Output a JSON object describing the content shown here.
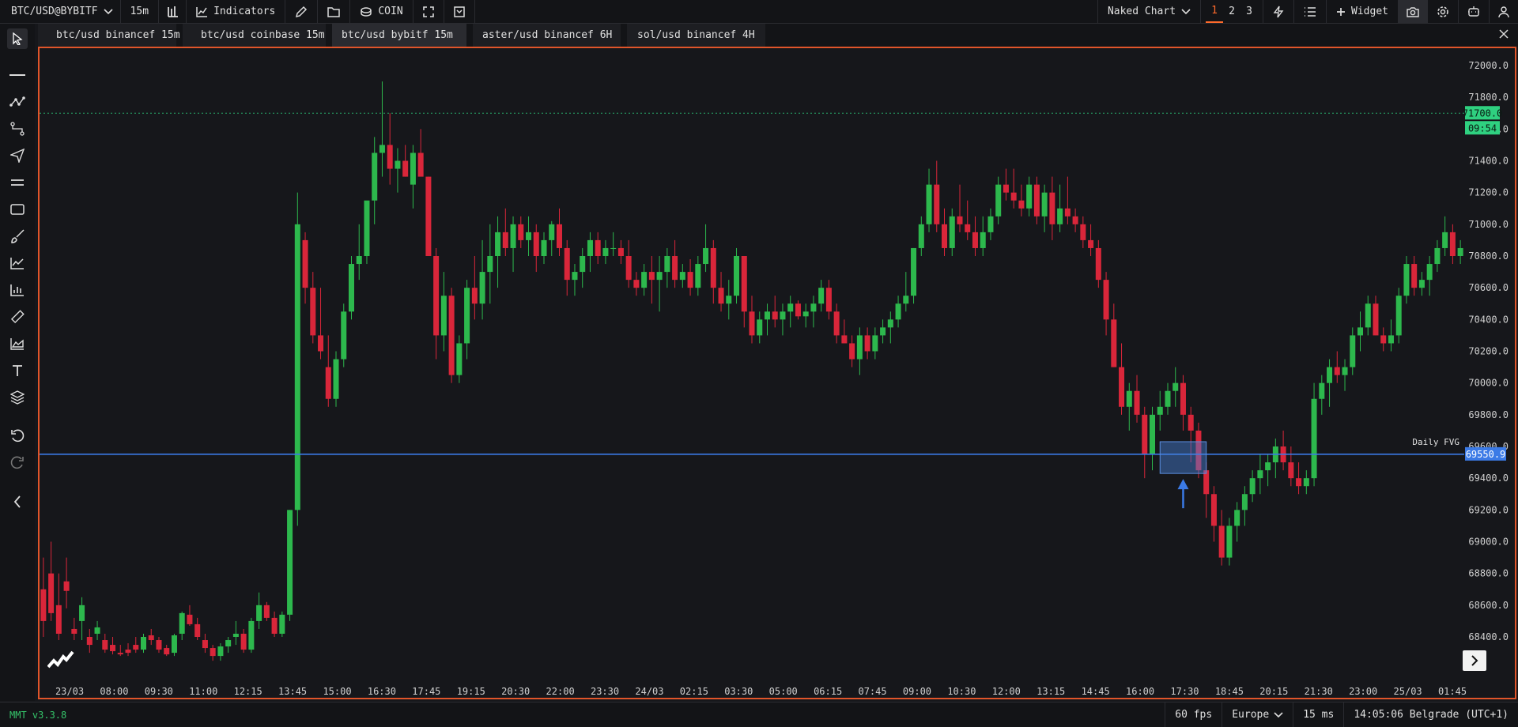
{
  "toolbar": {
    "symbol": "BTC/USD@BYBITF",
    "interval": "15m",
    "indicators_label": "Indicators",
    "coin_label": "COIN",
    "chart_mode": "Naked Chart",
    "layouts": [
      "1",
      "2",
      "3"
    ],
    "active_layout": "1",
    "widget_label": "Widget"
  },
  "tabs": [
    {
      "label": "btc/usd binancef 15m",
      "active": false
    },
    {
      "label": "btc/usd coinbase 15m",
      "active": false
    },
    {
      "label": "btc/usd bybitf 15m",
      "active": true
    },
    {
      "label": "aster/usd binancef 6H",
      "active": false
    },
    {
      "label": "sol/usd binancef 4H",
      "active": false
    }
  ],
  "sidebar": {
    "icons": [
      "cursor-icon",
      "horizontal-line-icon",
      "multi-point-icon",
      "path-icon",
      "send-icon",
      "parallel-lines-icon",
      "rectangle-icon",
      "brush-icon",
      "line-chart-icon",
      "bars-icon",
      "ruler-icon",
      "area-chart-icon",
      "text-icon",
      "layers-icon",
      "undo-icon",
      "redo-icon",
      "collapse-icon"
    ]
  },
  "chart_data": {
    "type": "candlestick",
    "y_axis_labels": [
      "72000.0",
      "71800.0",
      "71600.0",
      "71400.0",
      "71200.0",
      "71000.0",
      "70800.0",
      "70600.0",
      "70400.0",
      "70200.0",
      "70000.0",
      "69800.0",
      "69600.0",
      "69400.0",
      "69200.0",
      "69000.0",
      "68800.0",
      "68600.0",
      "68400.0"
    ],
    "ylim": [
      68400,
      72000
    ],
    "x_axis_labels": [
      "23/03",
      "08:00",
      "09:30",
      "11:00",
      "12:15",
      "13:45",
      "15:00",
      "16:30",
      "17:45",
      "19:15",
      "20:30",
      "22:00",
      "23:30",
      "24/03",
      "02:15",
      "03:30",
      "05:00",
      "06:15",
      "07:45",
      "09:00",
      "10:30",
      "12:00",
      "13:15",
      "14:45",
      "16:00",
      "17:30",
      "18:45",
      "20:15",
      "21:30",
      "23:00",
      "25/03",
      "01:45"
    ],
    "price_line": {
      "value": 71700.0,
      "label": "71700.0",
      "countdown": "09:54",
      "color": "#2fd080"
    },
    "level_line": {
      "value": 69550.9,
      "label": "69550.9",
      "name": "Daily FVG",
      "color": "#3b7ae6"
    },
    "highlight_zone": {
      "from": 69430,
      "to": 69630
    },
    "colors": {
      "up": "#2db84d",
      "down": "#d9263a"
    },
    "ohlc": [
      [
        68700,
        68900,
        68400,
        68500
      ],
      [
        68800,
        69000,
        68500,
        68550
      ],
      [
        68600,
        68800,
        68380,
        68420
      ],
      [
        68750,
        68900,
        68580,
        68690
      ],
      [
        68450,
        68520,
        68380,
        68420
      ],
      [
        68500,
        68650,
        68380,
        68600
      ],
      [
        68400,
        68450,
        68300,
        68350
      ],
      [
        68420,
        68500,
        68380,
        68460
      ],
      [
        68380,
        68420,
        68300,
        68320
      ],
      [
        68350,
        68400,
        68290,
        68310
      ],
      [
        68300,
        68350,
        68280,
        68290
      ],
      [
        68320,
        68360,
        68280,
        68300
      ],
      [
        68350,
        68400,
        68300,
        68320
      ],
      [
        68320,
        68420,
        68300,
        68400
      ],
      [
        68410,
        68450,
        68350,
        68380
      ],
      [
        68380,
        68400,
        68300,
        68320
      ],
      [
        68330,
        68350,
        68280,
        68290
      ],
      [
        68300,
        68420,
        68280,
        68410
      ],
      [
        68420,
        68560,
        68380,
        68550
      ],
      [
        68540,
        68600,
        68470,
        68480
      ],
      [
        68480,
        68520,
        68380,
        68400
      ],
      [
        68380,
        68420,
        68300,
        68330
      ],
      [
        68330,
        68350,
        68250,
        68280
      ],
      [
        68280,
        68360,
        68250,
        68340
      ],
      [
        68340,
        68400,
        68300,
        68380
      ],
      [
        68400,
        68500,
        68350,
        68420
      ],
      [
        68420,
        68450,
        68300,
        68320
      ],
      [
        68320,
        68520,
        68300,
        68500
      ],
      [
        68500,
        68680,
        68450,
        68600
      ],
      [
        68600,
        68620,
        68500,
        68520
      ],
      [
        68520,
        68560,
        68400,
        68420
      ],
      [
        68420,
        68560,
        68400,
        68540
      ],
      [
        68540,
        69200,
        68500,
        69200
      ],
      [
        69200,
        71200,
        69100,
        71000
      ],
      [
        70900,
        70950,
        70500,
        70600
      ],
      [
        70600,
        70700,
        70250,
        70300
      ],
      [
        70300,
        70600,
        70150,
        70200
      ],
      [
        70100,
        70300,
        69850,
        69900
      ],
      [
        69900,
        70200,
        69850,
        70150
      ],
      [
        70150,
        70500,
        70100,
        70450
      ],
      [
        70450,
        70800,
        70400,
        70750
      ],
      [
        70750,
        71000,
        70650,
        70800
      ],
      [
        70800,
        71100,
        70750,
        71150
      ],
      [
        71150,
        71550,
        71000,
        71450
      ],
      [
        71450,
        71900,
        71300,
        71500
      ],
      [
        71500,
        71700,
        71250,
        71350
      ],
      [
        71350,
        71480,
        71200,
        71400
      ],
      [
        71400,
        71500,
        71300,
        71300
      ],
      [
        71250,
        71500,
        71100,
        71450
      ],
      [
        71450,
        71600,
        71350,
        71300
      ],
      [
        71300,
        71300,
        70800,
        70800
      ],
      [
        70800,
        70850,
        70150,
        70300
      ],
      [
        70300,
        70700,
        70200,
        70550
      ],
      [
        70550,
        70600,
        70000,
        70050
      ],
      [
        70050,
        70300,
        70000,
        70250
      ],
      [
        70250,
        70650,
        70150,
        70600
      ],
      [
        70600,
        70800,
        70400,
        70500
      ],
      [
        70500,
        70900,
        70400,
        70700
      ],
      [
        70700,
        71000,
        70500,
        70800
      ],
      [
        70800,
        71050,
        70600,
        70950
      ],
      [
        70950,
        71100,
        70800,
        70850
      ],
      [
        70850,
        71050,
        70700,
        71000
      ],
      [
        71000,
        71050,
        70850,
        70900
      ],
      [
        70900,
        71050,
        70800,
        70950
      ],
      [
        70950,
        71000,
        70700,
        70800
      ],
      [
        70800,
        70950,
        70750,
        70900
      ],
      [
        70900,
        71020,
        70800,
        71000
      ],
      [
        71000,
        71100,
        70800,
        70850
      ],
      [
        70850,
        70900,
        70550,
        70650
      ],
      [
        70650,
        70750,
        70550,
        70700
      ],
      [
        70700,
        70850,
        70600,
        70800
      ],
      [
        70800,
        70950,
        70700,
        70900
      ],
      [
        70900,
        70950,
        70750,
        70800
      ],
      [
        70800,
        70900,
        70750,
        70850
      ],
      [
        70850,
        70950,
        70800,
        70850
      ],
      [
        70850,
        70900,
        70750,
        70800
      ],
      [
        70800,
        70900,
        70600,
        70650
      ],
      [
        70650,
        70700,
        70550,
        70600
      ],
      [
        70600,
        70750,
        70550,
        70700
      ],
      [
        70700,
        70800,
        70500,
        70650
      ],
      [
        70650,
        70800,
        70450,
        70700
      ],
      [
        70700,
        70850,
        70600,
        70800
      ],
      [
        70800,
        70900,
        70600,
        70650
      ],
      [
        70650,
        70750,
        70600,
        70700
      ],
      [
        70700,
        70780,
        70550,
        70600
      ],
      [
        70600,
        70800,
        70550,
        70750
      ],
      [
        70750,
        71000,
        70700,
        70850
      ],
      [
        70850,
        70900,
        70500,
        70600
      ],
      [
        70600,
        70700,
        70450,
        70500
      ],
      [
        70500,
        70650,
        70400,
        70550
      ],
      [
        70550,
        70850,
        70500,
        70800
      ],
      [
        70800,
        70800,
        70350,
        70450
      ],
      [
        70450,
        70550,
        70250,
        70300
      ],
      [
        70300,
        70450,
        70250,
        70400
      ],
      [
        70400,
        70500,
        70300,
        70450
      ],
      [
        70450,
        70550,
        70350,
        70400
      ],
      [
        70400,
        70500,
        70300,
        70450
      ],
      [
        70450,
        70550,
        70350,
        70500
      ],
      [
        70500,
        70520,
        70400,
        70420
      ],
      [
        70420,
        70500,
        70350,
        70450
      ],
      [
        70450,
        70550,
        70350,
        70500
      ],
      [
        70500,
        70650,
        70450,
        70600
      ],
      [
        70600,
        70650,
        70400,
        70450
      ],
      [
        70450,
        70500,
        70250,
        70300
      ],
      [
        70300,
        70400,
        70250,
        70250
      ],
      [
        70250,
        70300,
        70100,
        70150
      ],
      [
        70150,
        70350,
        70050,
        70300
      ],
      [
        70300,
        70350,
        70150,
        70200
      ],
      [
        70200,
        70350,
        70150,
        70300
      ],
      [
        70300,
        70400,
        70250,
        70350
      ],
      [
        70350,
        70450,
        70250,
        70400
      ],
      [
        70400,
        70550,
        70350,
        70500
      ],
      [
        70500,
        70700,
        70450,
        70550
      ],
      [
        70550,
        70850,
        70500,
        70850
      ],
      [
        70850,
        71050,
        70800,
        71000
      ],
      [
        71000,
        71350,
        70950,
        71250
      ],
      [
        71250,
        71400,
        70950,
        71000
      ],
      [
        71000,
        71100,
        70800,
        70850
      ],
      [
        70850,
        71100,
        70800,
        71050
      ],
      [
        71050,
        71250,
        70950,
        71000
      ],
      [
        71000,
        71150,
        70900,
        70950
      ],
      [
        70950,
        71050,
        70800,
        70850
      ],
      [
        70850,
        71050,
        70800,
        70950
      ],
      [
        70950,
        71100,
        70900,
        71050
      ],
      [
        71050,
        71300,
        71000,
        71250
      ],
      [
        71250,
        71350,
        71150,
        71200
      ],
      [
        71200,
        71350,
        71100,
        71150
      ],
      [
        71150,
        71250,
        71050,
        71100
      ],
      [
        71100,
        71300,
        71050,
        71250
      ],
      [
        71250,
        71300,
        71000,
        71050
      ],
      [
        71050,
        71250,
        70950,
        71200
      ],
      [
        71200,
        71300,
        70900,
        71000
      ],
      [
        71000,
        71250,
        70950,
        71100
      ],
      [
        71100,
        71300,
        71000,
        71050
      ],
      [
        71050,
        71100,
        70950,
        71000
      ],
      [
        71000,
        71050,
        70850,
        70900
      ],
      [
        70900,
        71000,
        70800,
        70850
      ],
      [
        70850,
        70900,
        70600,
        70650
      ],
      [
        70650,
        70700,
        70300,
        70400
      ],
      [
        70400,
        70500,
        70100,
        70100
      ],
      [
        70100,
        70250,
        69800,
        69850
      ],
      [
        69850,
        70000,
        69700,
        69950
      ],
      [
        69950,
        70050,
        69750,
        69800
      ],
      [
        69800,
        69850,
        69400,
        69550
      ],
      [
        69550,
        69850,
        69450,
        69800
      ],
      [
        69800,
        69950,
        69700,
        69850
      ],
      [
        69850,
        70000,
        69800,
        69950
      ],
      [
        69950,
        70100,
        69850,
        70000
      ],
      [
        70000,
        70050,
        69700,
        69800
      ],
      [
        69800,
        69850,
        69500,
        69700
      ],
      [
        69700,
        69750,
        69400,
        69450
      ],
      [
        69450,
        69500,
        69150,
        69300
      ],
      [
        69300,
        69350,
        69000,
        69100
      ],
      [
        69100,
        69200,
        68850,
        68900
      ],
      [
        68900,
        69150,
        68850,
        69100
      ],
      [
        69100,
        69250,
        69000,
        69200
      ],
      [
        69200,
        69350,
        69100,
        69300
      ],
      [
        69300,
        69450,
        69250,
        69400
      ],
      [
        69400,
        69550,
        69300,
        69450
      ],
      [
        69450,
        69550,
        69350,
        69500
      ],
      [
        69500,
        69650,
        69400,
        69600
      ],
      [
        69600,
        69700,
        69450,
        69500
      ],
      [
        69500,
        69600,
        69350,
        69400
      ],
      [
        69400,
        69500,
        69300,
        69350
      ],
      [
        69350,
        69450,
        69300,
        69400
      ],
      [
        69400,
        70000,
        69350,
        69900
      ],
      [
        69900,
        70050,
        69800,
        70000
      ],
      [
        70000,
        70150,
        69850,
        70100
      ],
      [
        70100,
        70200,
        70000,
        70050
      ],
      [
        70050,
        70150,
        69950,
        70100
      ],
      [
        70100,
        70350,
        70050,
        70300
      ],
      [
        70300,
        70450,
        70200,
        70350
      ],
      [
        70350,
        70550,
        70300,
        70500
      ],
      [
        70500,
        70550,
        70300,
        70300
      ],
      [
        70300,
        70350,
        70200,
        70250
      ],
      [
        70250,
        70400,
        70200,
        70300
      ],
      [
        70300,
        70600,
        70250,
        70550
      ],
      [
        70550,
        70800,
        70500,
        70750
      ],
      [
        70750,
        70800,
        70550,
        70600
      ],
      [
        70600,
        70700,
        70550,
        70650
      ],
      [
        70650,
        70800,
        70550,
        70750
      ],
      [
        70750,
        70900,
        70700,
        70850
      ],
      [
        70850,
        71050,
        70800,
        70950
      ],
      [
        70950,
        71000,
        70750,
        70800
      ],
      [
        70800,
        70900,
        70750,
        70850
      ]
    ]
  },
  "status": {
    "version": "MMT v3.3.8",
    "fps": "60 fps",
    "region": "Europe",
    "latency": "15 ms",
    "clock": "14:05:06 Belgrade (UTC+1)"
  }
}
